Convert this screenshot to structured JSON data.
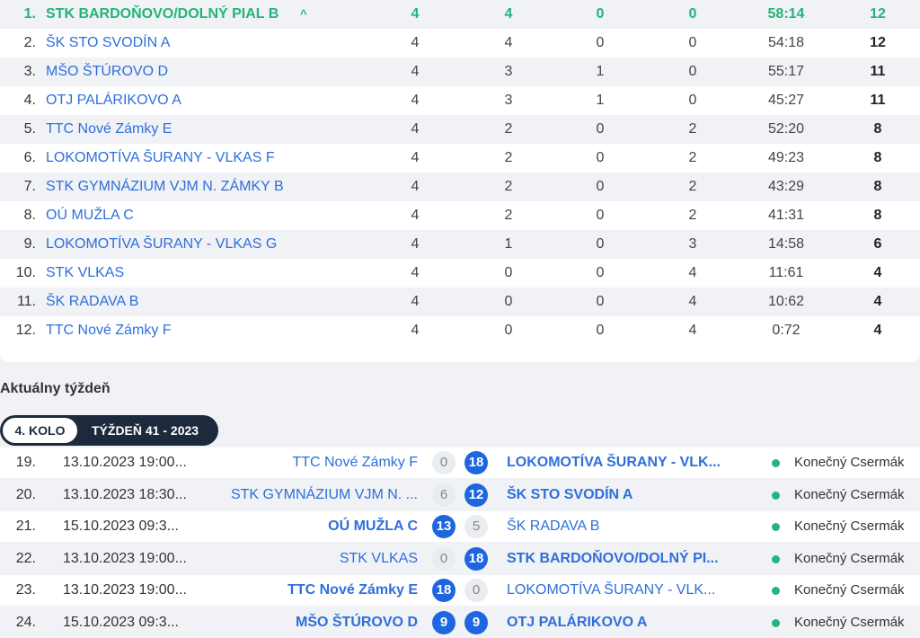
{
  "standings": [
    {
      "rank": "1.",
      "team": "STK BARDOŇOVO/DOLNÝ PIAL B",
      "played": "4",
      "won": "4",
      "drawn": "0",
      "lost": "0",
      "score": "58:14",
      "points": "12",
      "highlight": true,
      "arrow": "^"
    },
    {
      "rank": "2.",
      "team": "ŠK STO SVODÍN A",
      "played": "4",
      "won": "4",
      "drawn": "0",
      "lost": "0",
      "score": "54:18",
      "points": "12"
    },
    {
      "rank": "3.",
      "team": "MŠO ŠTÚROVO D",
      "played": "4",
      "won": "3",
      "drawn": "1",
      "lost": "0",
      "score": "55:17",
      "points": "11"
    },
    {
      "rank": "4.",
      "team": "OTJ PALÁRIKOVO A",
      "played": "4",
      "won": "3",
      "drawn": "1",
      "lost": "0",
      "score": "45:27",
      "points": "11"
    },
    {
      "rank": "5.",
      "team": "TTC Nové Zámky E",
      "played": "4",
      "won": "2",
      "drawn": "0",
      "lost": "2",
      "score": "52:20",
      "points": "8"
    },
    {
      "rank": "6.",
      "team": "LOKOMOTÍVA ŠURANY - VLKAS F",
      "played": "4",
      "won": "2",
      "drawn": "0",
      "lost": "2",
      "score": "49:23",
      "points": "8"
    },
    {
      "rank": "7.",
      "team": "STK GYMNÁZIUM VJM N. ZÁMKY B",
      "played": "4",
      "won": "2",
      "drawn": "0",
      "lost": "2",
      "score": "43:29",
      "points": "8"
    },
    {
      "rank": "8.",
      "team": "OÚ MUŽLA C",
      "played": "4",
      "won": "2",
      "drawn": "0",
      "lost": "2",
      "score": "41:31",
      "points": "8"
    },
    {
      "rank": "9.",
      "team": "LOKOMOTÍVA ŠURANY - VLKAS G",
      "played": "4",
      "won": "1",
      "drawn": "0",
      "lost": "3",
      "score": "14:58",
      "points": "6"
    },
    {
      "rank": "10.",
      "team": "STK VLKAS",
      "played": "4",
      "won": "0",
      "drawn": "0",
      "lost": "4",
      "score": "11:61",
      "points": "4"
    },
    {
      "rank": "11.",
      "team": "ŠK RADAVA B",
      "played": "4",
      "won": "0",
      "drawn": "0",
      "lost": "4",
      "score": "10:62",
      "points": "4"
    },
    {
      "rank": "12.",
      "team": "TTC Nové Zámky F",
      "played": "4",
      "won": "0",
      "drawn": "0",
      "lost": "4",
      "score": "0:72",
      "points": "4"
    }
  ],
  "current_week": {
    "title": "Aktuálny týždeň",
    "round_tab": "4. KOLO",
    "week_tab": "TÝŽDEŇ 41 - 2023"
  },
  "matches": [
    {
      "no": "19.",
      "date": "13.10.2023 19:00...",
      "home": "TTC Nové Zámky F",
      "home_score": "0",
      "away_score": "18",
      "away": "LOKOMOTÍVA ŠURANY - VLK...",
      "winner": "away",
      "status": "Konečný Csermák"
    },
    {
      "no": "20.",
      "date": "13.10.2023 18:30...",
      "home": "STK GYMNÁZIUM VJM N. ...",
      "home_score": "6",
      "away_score": "12",
      "away": "ŠK STO SVODÍN A",
      "winner": "away",
      "status": "Konečný Csermák"
    },
    {
      "no": "21.",
      "date": "15.10.2023 09:3...",
      "home": "OÚ MUŽLA C",
      "home_score": "13",
      "away_score": "5",
      "away": "ŠK RADAVA B",
      "winner": "home",
      "status": "Konečný Csermák"
    },
    {
      "no": "22.",
      "date": "13.10.2023 19:00...",
      "home": "STK VLKAS",
      "home_score": "0",
      "away_score": "18",
      "away": "STK BARDOŇOVO/DOLNÝ PI...",
      "winner": "away",
      "status": "Konečný Csermák"
    },
    {
      "no": "23.",
      "date": "13.10.2023 19:00...",
      "home": "TTC Nové Zámky E",
      "home_score": "18",
      "away_score": "0",
      "away": "LOKOMOTÍVA ŠURANY - VLK...",
      "winner": "home",
      "status": "Konečný Csermák"
    },
    {
      "no": "24.",
      "date": "15.10.2023 09:3...",
      "home": "MŠO ŠTÚROVO D",
      "home_score": "9",
      "away_score": "9",
      "away": "OTJ PALÁRIKOVO A",
      "winner": "draw",
      "status": "Konečný Csermák"
    }
  ],
  "colors": {
    "accent": "#1e66e0",
    "link": "#2e6fdb",
    "leader": "#22b57a",
    "status_dot": "#21b67a",
    "dark_tab": "#1d2a3d"
  }
}
